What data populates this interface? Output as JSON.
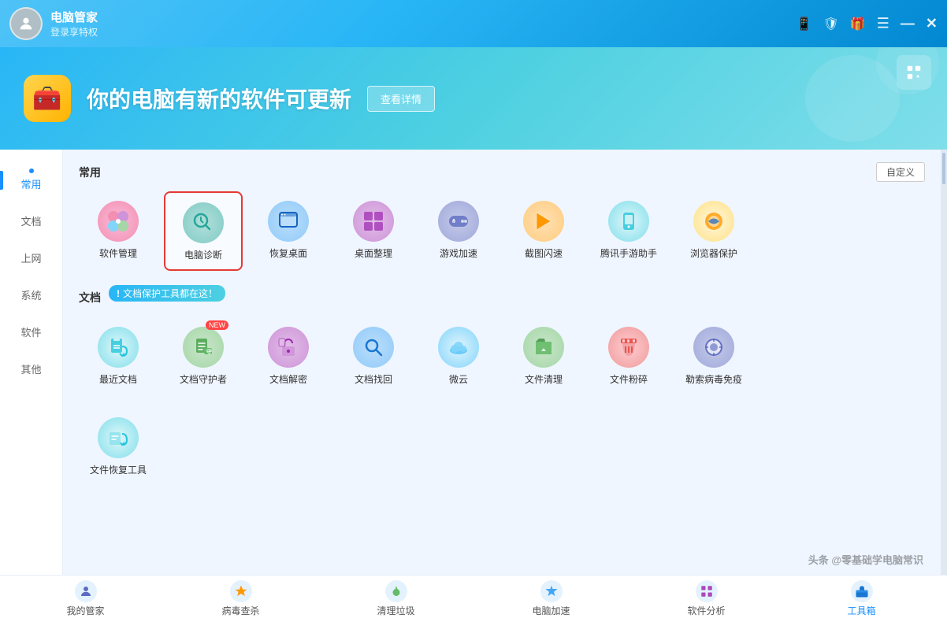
{
  "titlebar": {
    "title": "电脑管家",
    "subtitle": "登录享特权",
    "controls": [
      "phone-icon",
      "shield-icon",
      "gift-icon",
      "menu-icon",
      "minimize-icon",
      "close-icon"
    ]
  },
  "banner": {
    "icon": "🧰",
    "text": "你的电脑有新的软件可更新",
    "button_label": "查看详情"
  },
  "sidebar": {
    "items": [
      {
        "id": "common",
        "label": "常用",
        "active": true
      },
      {
        "id": "doc",
        "label": "文档",
        "active": false
      },
      {
        "id": "internet",
        "label": "上网",
        "active": false
      },
      {
        "id": "system",
        "label": "系统",
        "active": false
      },
      {
        "id": "software",
        "label": "软件",
        "active": false
      },
      {
        "id": "other",
        "label": "其他",
        "active": false
      }
    ]
  },
  "content": {
    "customize_label": "自定义",
    "section_common": {
      "title": "常用",
      "tools": [
        {
          "id": "software-mgr",
          "label": "软件管理",
          "icon": "🍀",
          "icon_class": "icon-pink",
          "highlighted": false
        },
        {
          "id": "pc-diagnose",
          "label": "电脑诊断",
          "icon": "🩺",
          "icon_class": "icon-teal",
          "highlighted": true
        },
        {
          "id": "restore-desktop",
          "label": "恢复桌面",
          "icon": "🪟",
          "icon_class": "icon-blue",
          "highlighted": false
        },
        {
          "id": "desktop-arrange",
          "label": "桌面整理",
          "icon": "🖥",
          "icon_class": "icon-purple",
          "highlighted": false
        },
        {
          "id": "game-speedup",
          "label": "游戏加速",
          "icon": "🎮",
          "icon_class": "icon-indigo",
          "highlighted": false
        },
        {
          "id": "format-factory",
          "label": "截图闪速",
          "icon": "⚡",
          "icon_class": "icon-orange",
          "highlighted": false
        },
        {
          "id": "tencent-assistant",
          "label": "腾讯手游助手",
          "icon": "📱",
          "icon_class": "icon-cyan",
          "highlighted": false
        },
        {
          "id": "browser-protect",
          "label": "浏览器保护",
          "icon": "🦊",
          "icon_class": "icon-amber",
          "highlighted": false
        }
      ]
    },
    "section_doc": {
      "tag": "文档保护工具都在这！",
      "tools": [
        {
          "id": "recent-doc",
          "label": "最近文档",
          "icon": "📄",
          "icon_class": "icon-cyan",
          "badge": false
        },
        {
          "id": "doc-guardian",
          "label": "文档守护者",
          "icon": "📝",
          "icon_class": "icon-green",
          "badge": true
        },
        {
          "id": "doc-unlock",
          "label": "文档解密",
          "icon": "📂",
          "icon_class": "icon-purple",
          "badge": false
        },
        {
          "id": "doc-recover",
          "label": "文档找回",
          "icon": "🔍",
          "icon_class": "icon-blue",
          "badge": false
        },
        {
          "id": "cloud",
          "label": "微云",
          "icon": "☁️",
          "icon_class": "icon-lightblue",
          "badge": false
        },
        {
          "id": "file-manage",
          "label": "文件清理",
          "icon": "🗂",
          "icon_class": "icon-green",
          "badge": false
        },
        {
          "id": "file-shred",
          "label": "文件粉碎",
          "icon": "🖨",
          "icon_class": "icon-red",
          "badge": false
        },
        {
          "id": "virus-immune",
          "label": "勒索病毒免疫",
          "icon": "🛡",
          "icon_class": "icon-indigo",
          "badge": false
        }
      ]
    },
    "section_doc2": {
      "tools": [
        {
          "id": "file-recover",
          "label": "文件恢复工具",
          "icon": "🔄",
          "icon_class": "icon-cyan",
          "badge": false
        }
      ]
    }
  },
  "bottom_bar": {
    "items": [
      {
        "id": "my-mgr",
        "label": "我的管家",
        "icon": "👤",
        "active": false
      },
      {
        "id": "virus-kill",
        "label": "病毒查杀",
        "icon": "⚡",
        "active": false
      },
      {
        "id": "clean-junk",
        "label": "清理垃圾",
        "icon": "🧹",
        "active": false
      },
      {
        "id": "pc-speedup",
        "label": "电脑加速",
        "icon": "🚀",
        "active": false
      },
      {
        "id": "software-mgr2",
        "label": "软件分析",
        "icon": "📊",
        "active": false
      },
      {
        "id": "toolbox",
        "label": "工具箱",
        "icon": "🧰",
        "active": true
      }
    ]
  },
  "watermark": {
    "text": "头条 @零基础学电脑常识"
  }
}
